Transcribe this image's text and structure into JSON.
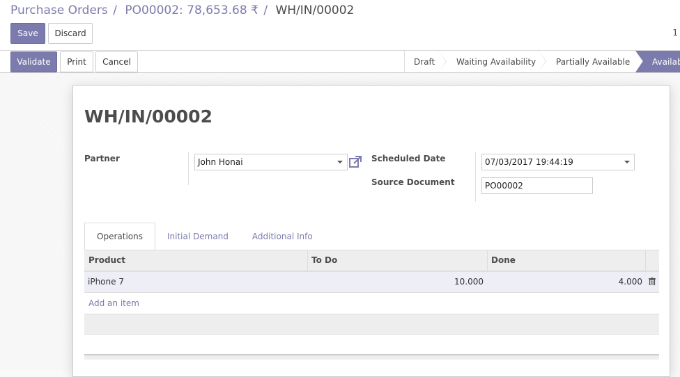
{
  "breadcrumb": {
    "items": [
      "Purchase Orders",
      "PO00002: 78,653.68 ₹"
    ],
    "separator": "/",
    "current": "WH/IN/00002"
  },
  "toolbar": {
    "save_label": "Save",
    "discard_label": "Discard"
  },
  "pager": {
    "value": "1"
  },
  "actions": {
    "validate_label": "Validate",
    "print_label": "Print",
    "cancel_label": "Cancel"
  },
  "statusbar": {
    "steps": [
      "Draft",
      "Waiting Availability",
      "Partially Available",
      "Availab"
    ],
    "active_index": 3
  },
  "form": {
    "title": "WH/IN/00002",
    "partner_label": "Partner",
    "partner_value": "John Honai",
    "scheduled_date_label": "Scheduled Date",
    "scheduled_date_value": "07/03/2017 19:44:19",
    "source_document_label": "Source Document",
    "source_document_value": "PO00002"
  },
  "tabs": [
    {
      "label": "Operations",
      "active": true
    },
    {
      "label": "Initial Demand",
      "active": false
    },
    {
      "label": "Additional Info",
      "active": false
    }
  ],
  "table": {
    "headers": [
      "Product",
      "To Do",
      "Done"
    ],
    "rows": [
      {
        "product": "iPhone 7",
        "todo": "10.000",
        "done": "4.000"
      }
    ],
    "add_item_label": "Add an item"
  },
  "colors": {
    "primary": "#7c7bad",
    "text": "#4c4c4c"
  }
}
